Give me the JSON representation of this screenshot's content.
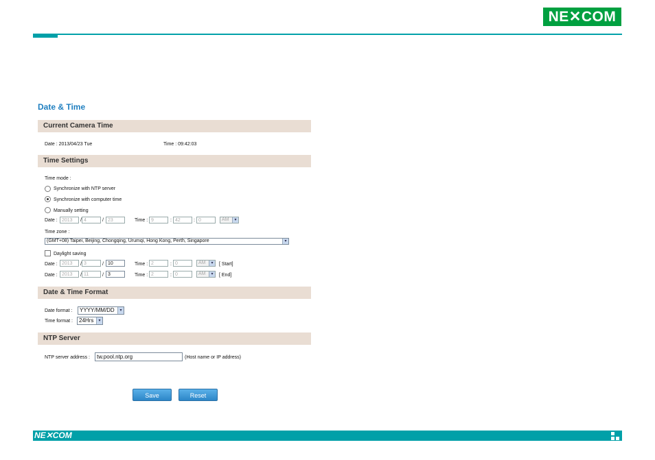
{
  "brand": {
    "logo": "NE✕COM",
    "footer_logo": "NE✕COM",
    "accent": "#00a0a8",
    "logo_green": "#00a040"
  },
  "page_title": "Date & Time",
  "current": {
    "header": "Current Camera Time",
    "date_label": "Date : 2013/04/23 Tue",
    "time_label": "Time : 09:42:03"
  },
  "settings": {
    "header": "Time Settings",
    "time_mode_label": "Time mode :",
    "options": [
      "Synchronize with NTP server",
      "Synchronize with computer time",
      "Manually setting"
    ],
    "selected_option": "Synchronize with computer time",
    "date_label": "Date :",
    "time_label": "Time :",
    "manual": {
      "year": "2013",
      "month": "4",
      "day": "23",
      "hour": "9",
      "minute": "42",
      "second": "0",
      "ampm": "AM"
    },
    "sep_slash": "/",
    "sep_colon": ":",
    "timezone_label": "Time zone :",
    "timezone_value": "(GMT+08) Taipei, Beijing, Chongqing, Urumqi, Hong Kong, Perth, Singapore",
    "dst_label": "Daylight saving",
    "dst_start": {
      "year": "2013",
      "month": "3",
      "day": "10",
      "hour": "2",
      "minute": "0",
      "ampm": "AM",
      "tag": "[ Start]"
    },
    "dst_end": {
      "year": "2013",
      "month": "11",
      "day": "3",
      "hour": "2",
      "minute": "0",
      "ampm": "AM",
      "tag": "[ End]"
    }
  },
  "format": {
    "header": "Date & Time Format",
    "date_format_label": "Date format :",
    "date_format_value": "YYYY/MM/DD",
    "time_format_label": "Time format :",
    "time_format_value": "24Hrs"
  },
  "ntp": {
    "header": "NTP Server",
    "address_label": "NTP server address :",
    "address_value": "tw.pool.ntp.org",
    "hint": "(Host name or IP address)"
  },
  "buttons": {
    "save": "Save",
    "reset": "Reset"
  }
}
